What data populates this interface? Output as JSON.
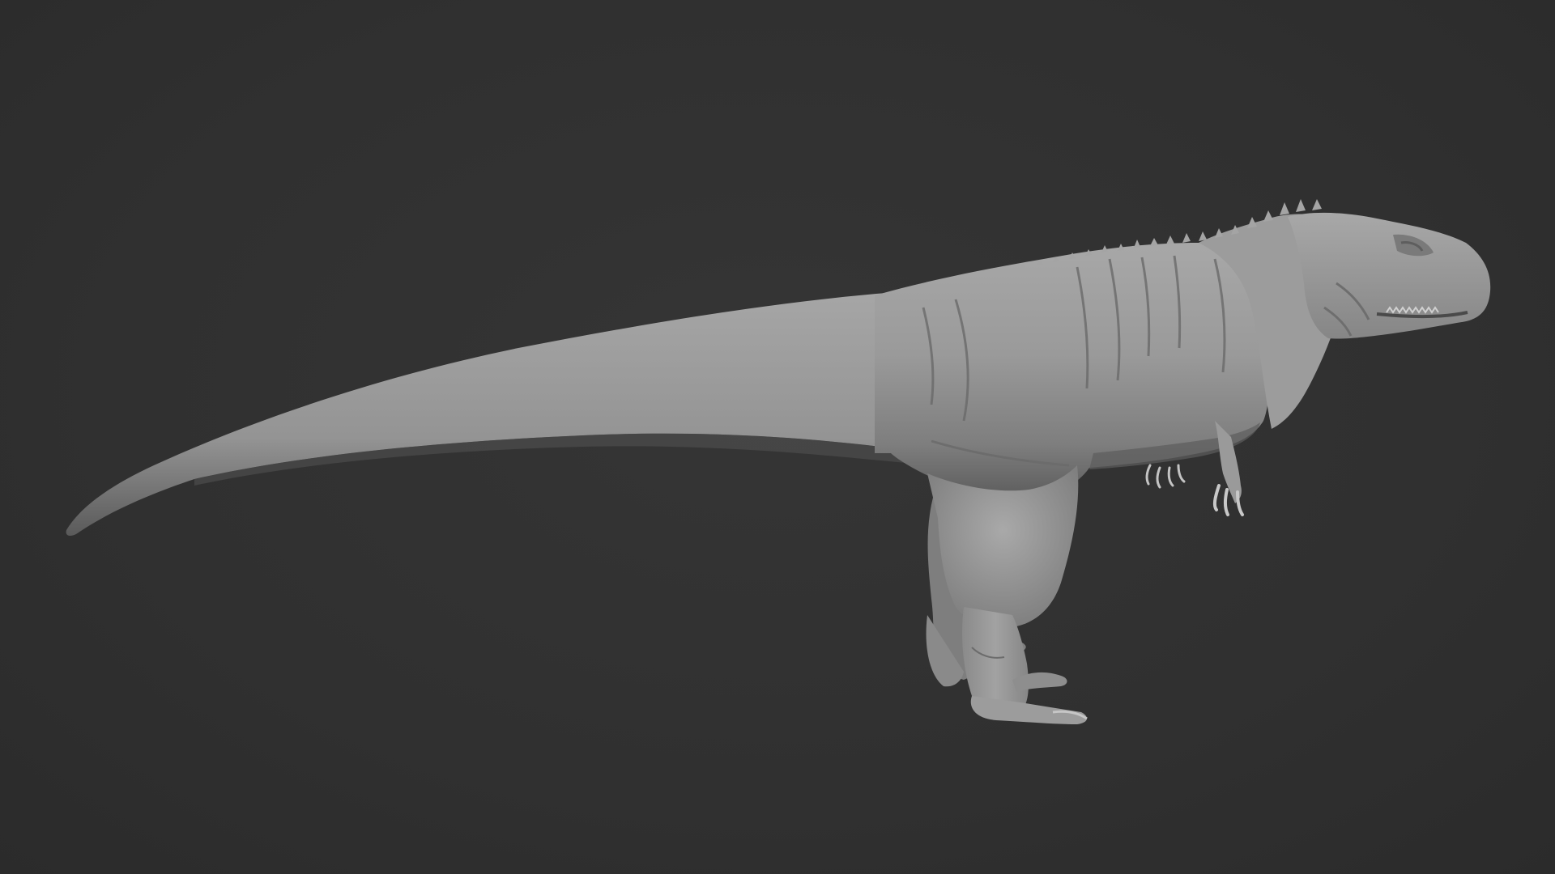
{
  "viewport": {
    "background_color": "#313131",
    "shading": "matcap-clay"
  },
  "model": {
    "subject": "theropod-dinosaur-sculpt",
    "view": "side-profile-right",
    "base_color": "#9a9a9a",
    "shadow_color": "#4c4c4c",
    "highlight_color": "#c4c4c4"
  }
}
